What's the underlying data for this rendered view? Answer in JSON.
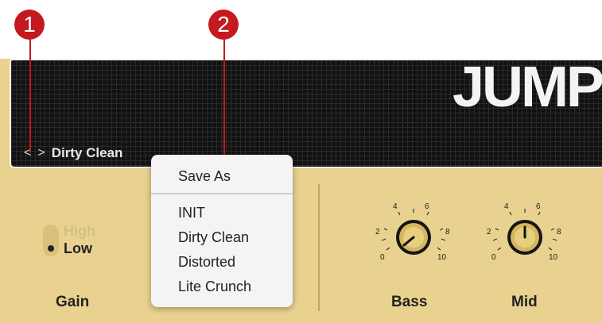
{
  "callouts": [
    "1",
    "2"
  ],
  "header": {
    "logo": "JUMP",
    "prev_glyph": "<",
    "next_glyph": ">",
    "preset_name": "Dirty Clean"
  },
  "preset_menu": {
    "save_as": "Save As",
    "items": [
      "INIT",
      "Dirty Clean",
      "Distorted",
      "Lite Crunch"
    ]
  },
  "gain_switch": {
    "high_label": "High",
    "low_label": "Low",
    "selected": "Low"
  },
  "controls": {
    "gain_label": "Gain",
    "bass_label": "Bass",
    "mid_label": "Mid"
  },
  "knob_scale": [
    "0",
    "2",
    "4",
    "6",
    "8",
    "10"
  ],
  "colors": {
    "amp_panel": "#e9d18f",
    "callout": "#c41a1f",
    "grille": "#121212"
  }
}
